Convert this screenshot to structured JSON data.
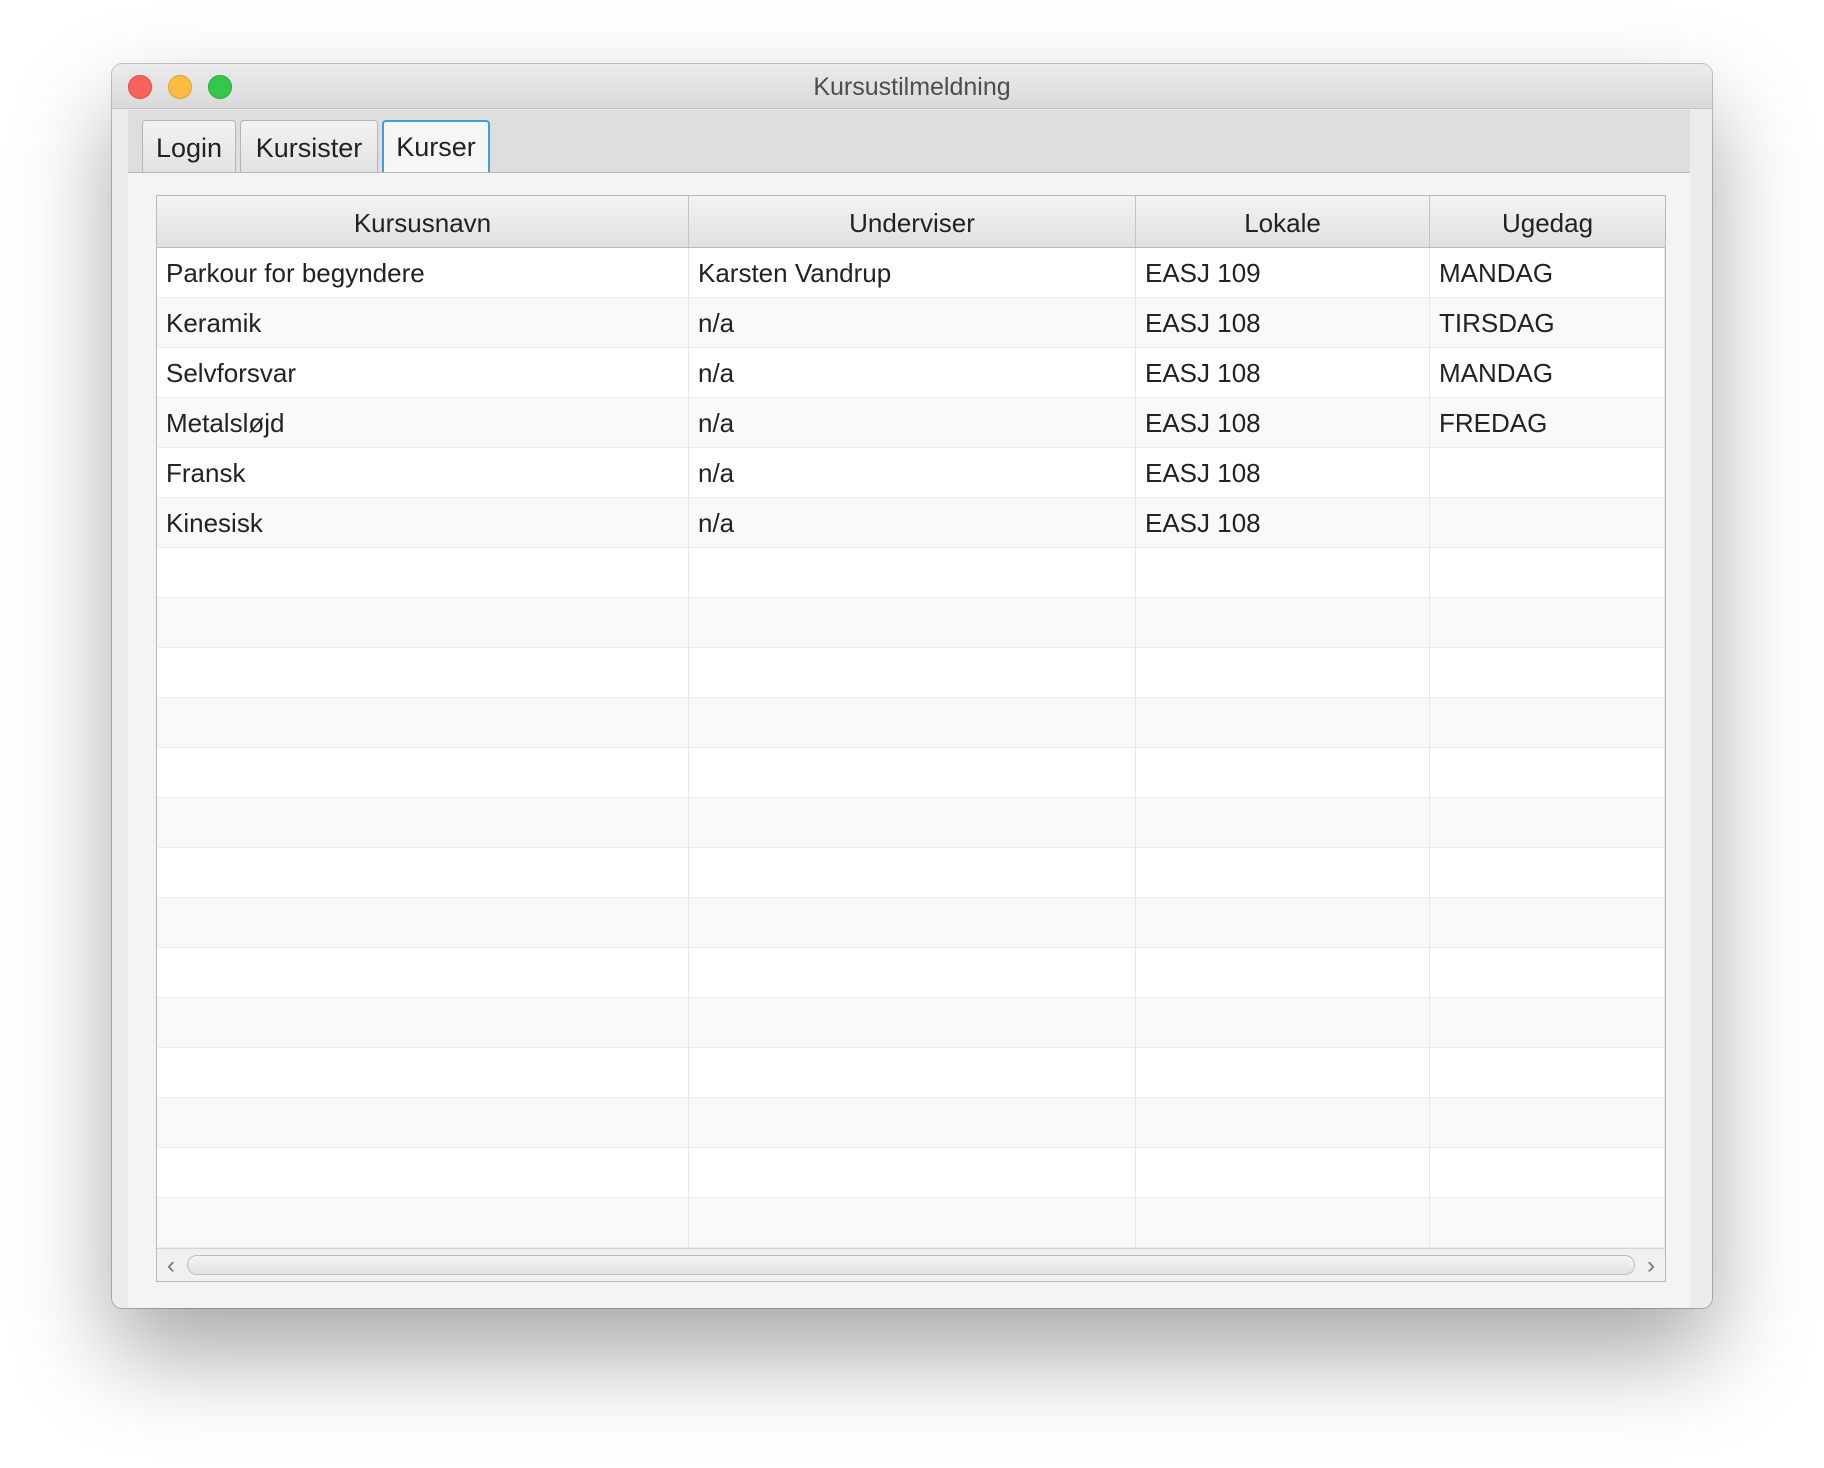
{
  "window": {
    "title": "Kursustilmeldning"
  },
  "tabs": [
    {
      "label": "Login",
      "selected": false
    },
    {
      "label": "Kursister",
      "selected": false
    },
    {
      "label": "Kurser",
      "selected": true
    }
  ],
  "colors": {
    "selected_tab_border": "#3d9ed8",
    "close": "#fc605b",
    "minimize": "#fdbc40",
    "maximize": "#34c84a"
  },
  "table": {
    "columns": [
      "Kursusnavn",
      "Underviser",
      "Lokale",
      "Ugedag"
    ],
    "rows": [
      [
        "Parkour for begyndere",
        "Karsten Vandrup",
        "EASJ 109",
        "MANDAG"
      ],
      [
        "Keramik",
        "n/a",
        "EASJ 108",
        "TIRSDAG"
      ],
      [
        "Selvforsvar",
        "n/a",
        "EASJ 108",
        "MANDAG"
      ],
      [
        "Metalsløjd",
        "n/a",
        "EASJ 108",
        "FREDAG"
      ],
      [
        "Fransk",
        "n/a",
        "EASJ 108",
        ""
      ],
      [
        "Kinesisk",
        "n/a",
        "EASJ 108",
        ""
      ]
    ]
  },
  "scrollbar": {
    "left_icon": "chevron-left-icon",
    "right_icon": "chevron-right-icon",
    "left_glyph": "‹",
    "right_glyph": "›"
  }
}
